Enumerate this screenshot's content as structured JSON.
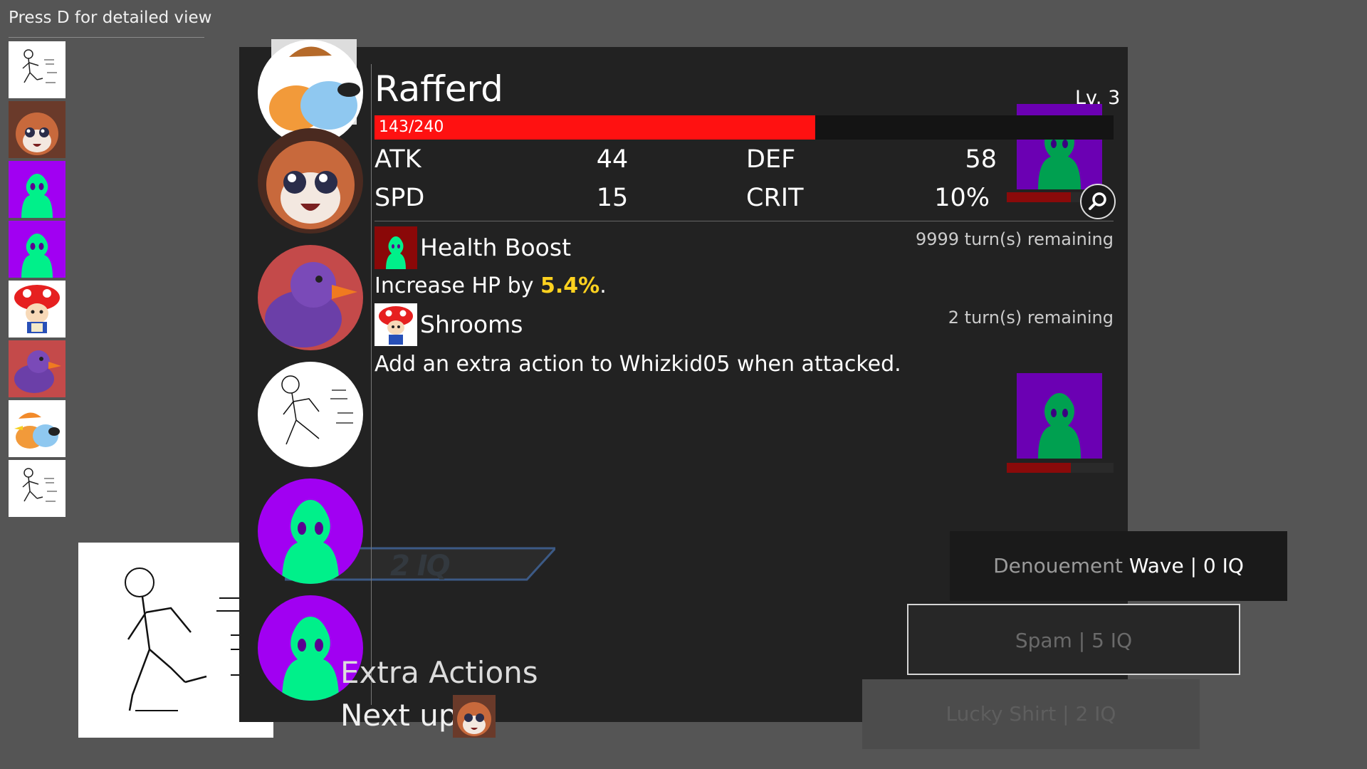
{
  "hint": "Press D for detailed view",
  "turn_order": [
    {
      "name": "stickman",
      "icon": "stickman-icon"
    },
    {
      "name": "fox",
      "icon": "fox-icon"
    },
    {
      "name": "purple-blob",
      "icon": "blob-icon"
    },
    {
      "name": "purple-blob",
      "icon": "blob-icon"
    },
    {
      "name": "toad",
      "icon": "toad-icon"
    },
    {
      "name": "duck",
      "icon": "duck-icon"
    },
    {
      "name": "bird",
      "icon": "bird-icon"
    },
    {
      "name": "stickman",
      "icon": "stickman-icon"
    }
  ],
  "iq_bar": {
    "label": "2 IQ"
  },
  "character": {
    "name": "Rafferd",
    "level": "Lv. 3",
    "hp_text": "143/240",
    "hp_fraction": 0.596,
    "stats": [
      {
        "label": "ATK",
        "value": "44"
      },
      {
        "label": "DEF",
        "value": "58"
      },
      {
        "label": "SPD",
        "value": "15"
      },
      {
        "label": "CRIT",
        "value": "10%"
      }
    ]
  },
  "statuses": [
    {
      "name": "Health Boost",
      "turns": "9999 turn(s) remaining",
      "desc_prefix": "Increase HP by ",
      "desc_highlight": "5.4%",
      "desc_suffix": "."
    },
    {
      "name": "Shrooms",
      "turns": "2 turn(s) remaining",
      "desc": "Add an extra action to Whizkid05 when attacked."
    }
  ],
  "enemies": [
    {
      "hp_fraction": 0.6
    },
    {
      "hp_fraction": 0.6
    }
  ],
  "skills": [
    {
      "name_dim": "Denouement",
      "name_rest": " Wave | 0 IQ"
    },
    {
      "label": "Spam | 5 IQ"
    },
    {
      "label": "Lucky Shirt | 2 IQ"
    }
  ],
  "footer": {
    "extra_actions": "Extra Actions",
    "next_up": "Next up:"
  },
  "colors": {
    "hp": "#ff1111",
    "enemy_bg": "#6b00b3",
    "blob": "#00f08a",
    "highlight": "#ffd21f"
  }
}
